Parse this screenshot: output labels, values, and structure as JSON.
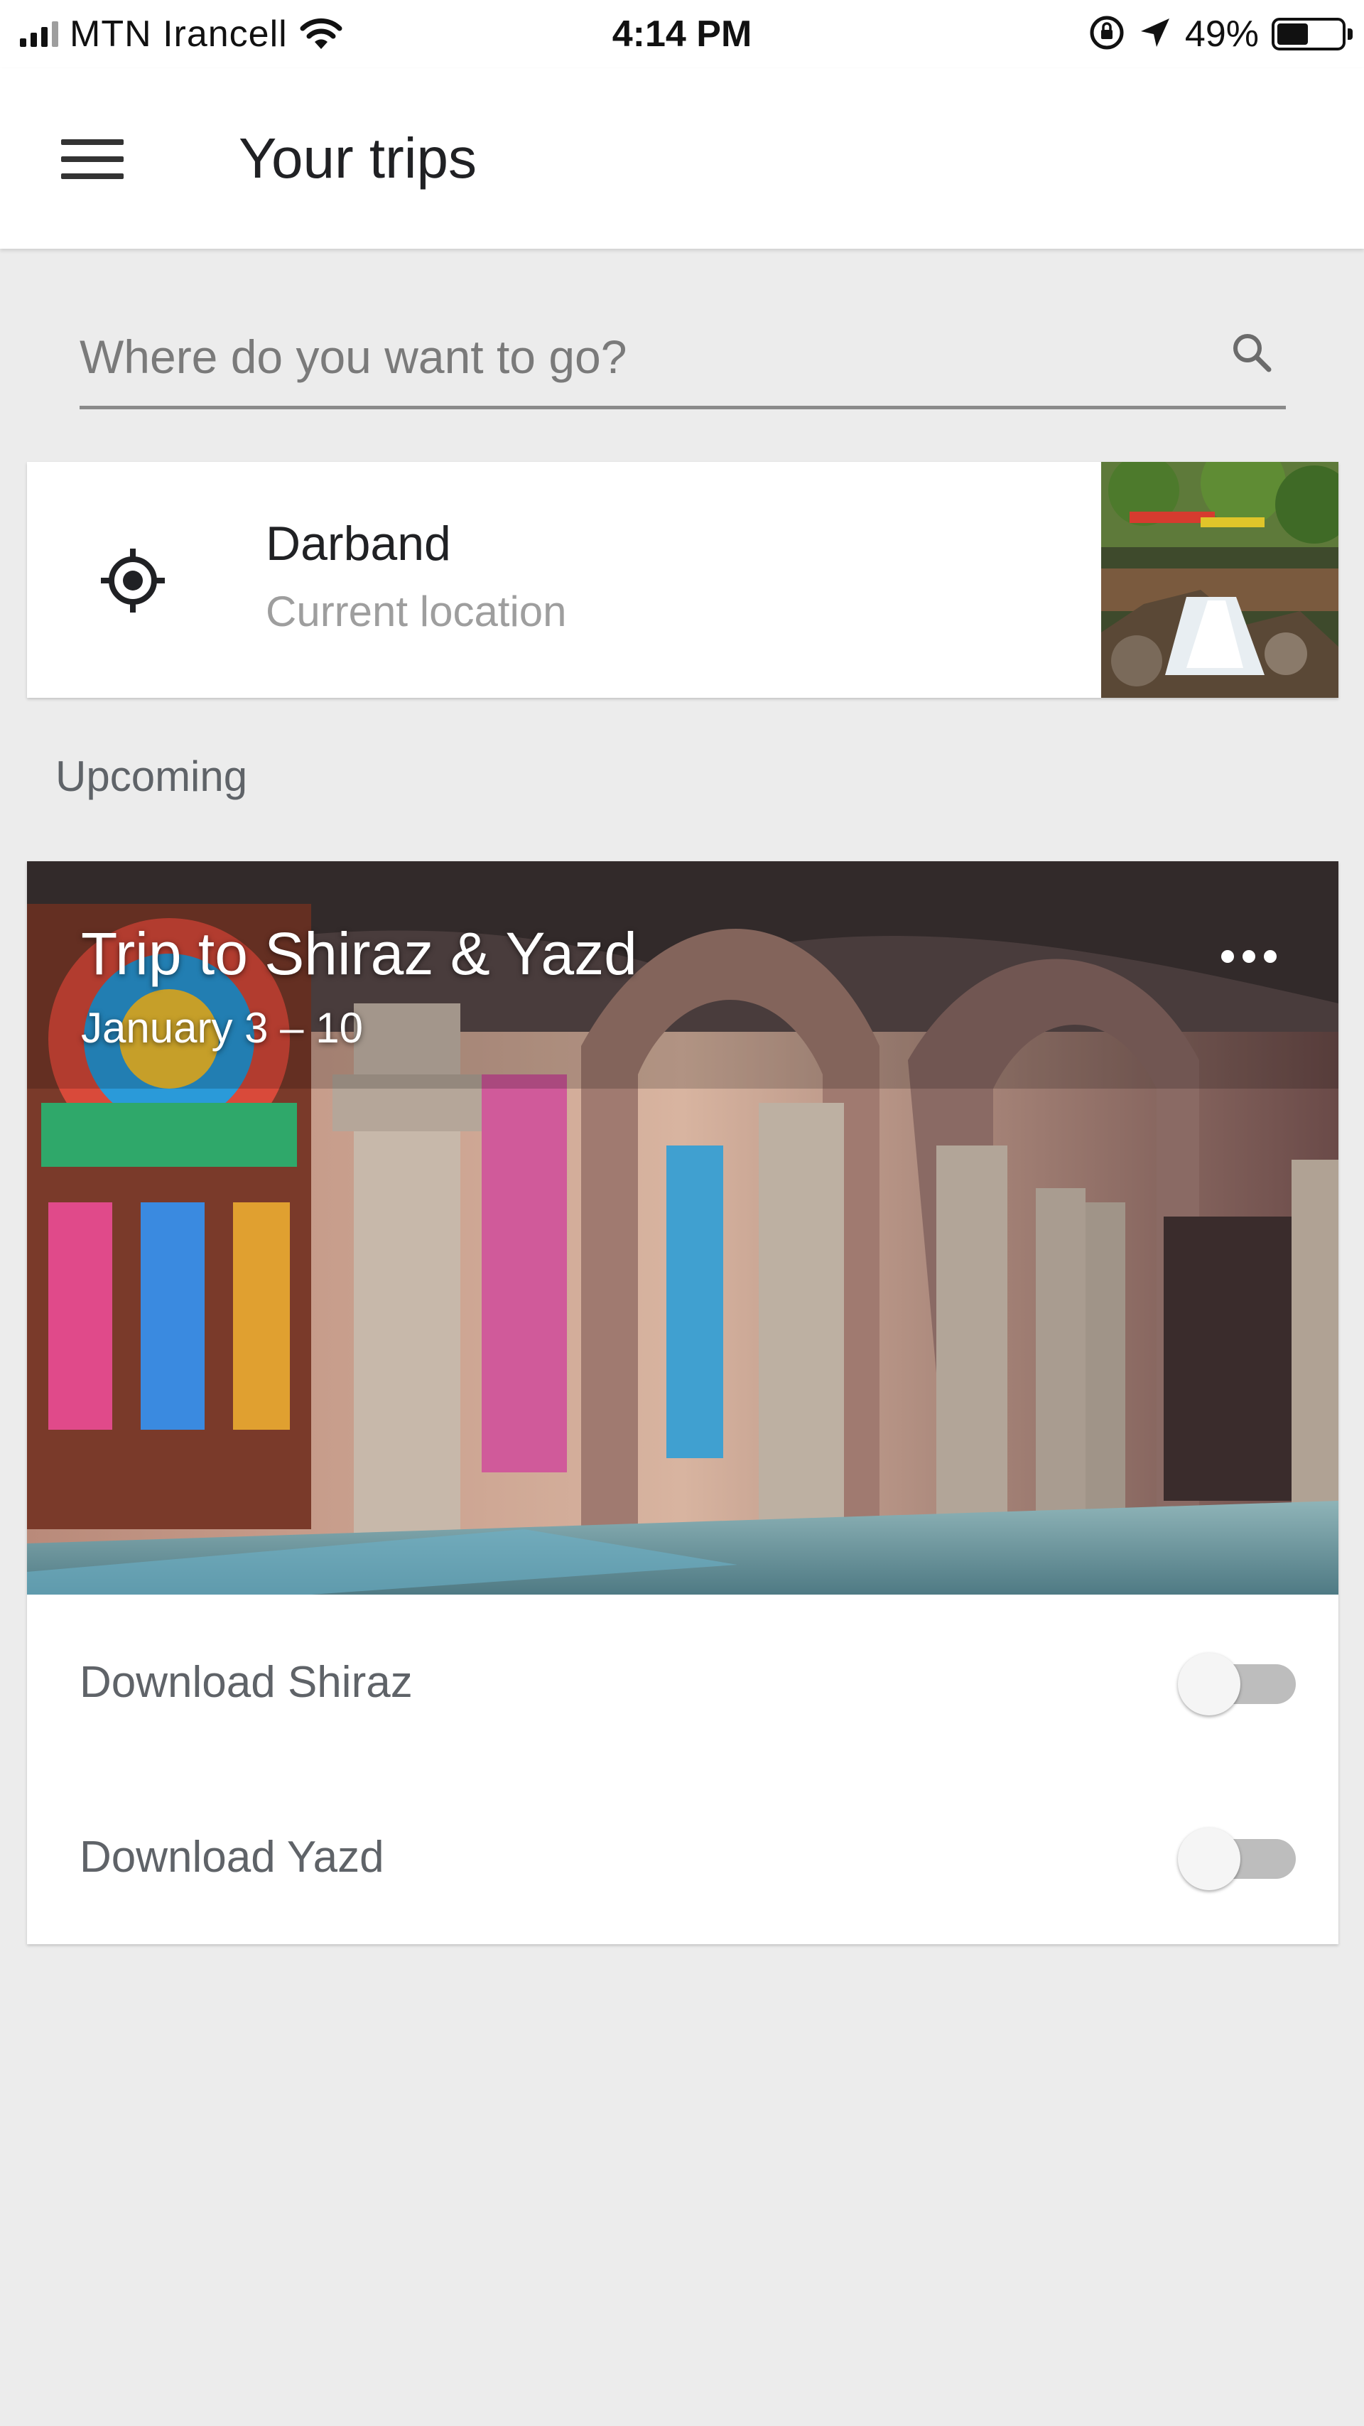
{
  "status_bar": {
    "carrier": "MTN Irancell",
    "time": "4:14 PM",
    "battery_percent": "49%",
    "battery_level": 0.49,
    "icons": [
      "signal-icon",
      "wifi-icon",
      "orientation-lock-icon",
      "location-arrow-icon",
      "battery-icon"
    ]
  },
  "header": {
    "menu_icon": "hamburger-menu-icon",
    "title": "Your trips"
  },
  "search": {
    "placeholder": "Where do you want to go?",
    "value": "",
    "icon": "search-icon"
  },
  "current_location": {
    "icon": "my-location-icon",
    "title": "Darband",
    "subtitle": "Current location"
  },
  "sections": {
    "upcoming_label": "Upcoming"
  },
  "trip": {
    "title": "Trip to Shiraz & Yazd",
    "dates": "January 3 – 10",
    "more_icon": "more-horizontal-icon",
    "downloads": [
      {
        "label": "Download Shiraz",
        "enabled": false
      },
      {
        "label": "Download Yazd",
        "enabled": false
      }
    ]
  },
  "colors": {
    "background": "#ececec",
    "card": "#ffffff",
    "secondary_text": "#5f6368",
    "toggle_track_off": "#bdbdbd"
  }
}
